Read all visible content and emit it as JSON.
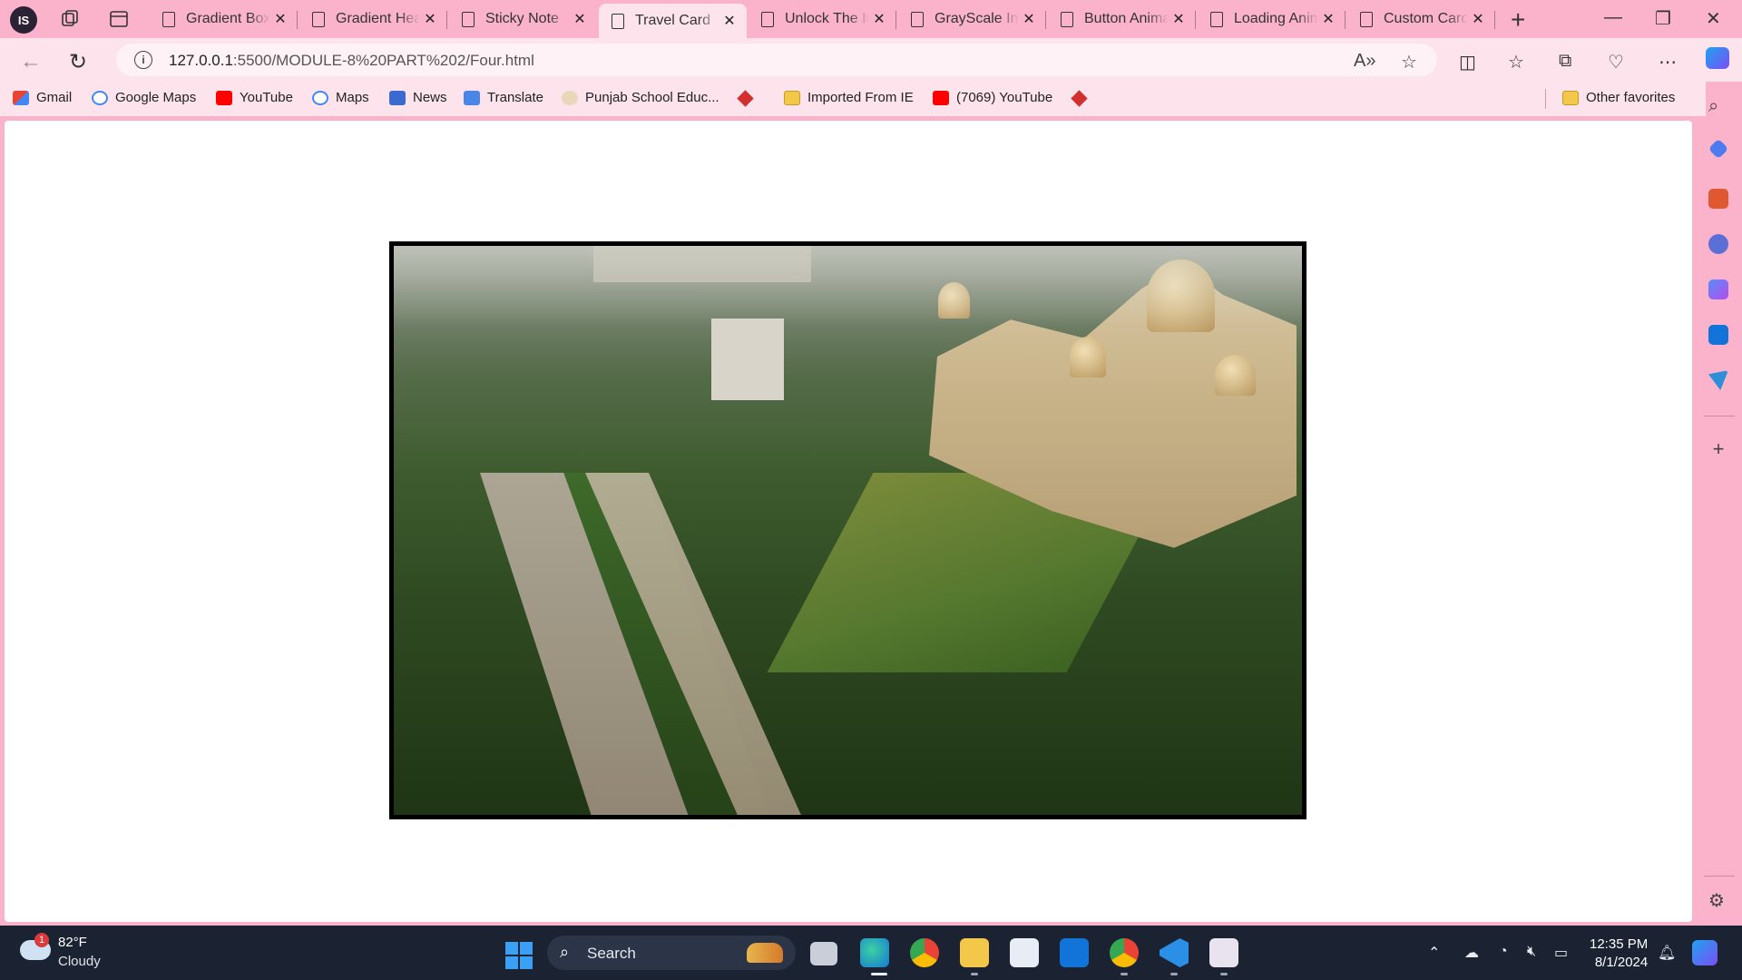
{
  "browser": {
    "profile_initials": "IS",
    "tabs": [
      {
        "title": "Gradient Box",
        "active": false
      },
      {
        "title": "Gradient Header",
        "active": false
      },
      {
        "title": "Sticky Note",
        "active": false
      },
      {
        "title": "Travel Card",
        "active": true
      },
      {
        "title": "Unlock The Image",
        "active": false
      },
      {
        "title": "GrayScale Image",
        "active": false
      },
      {
        "title": "Button Animation",
        "active": false
      },
      {
        "title": "Loading Animation",
        "active": false
      },
      {
        "title": "Custom Card",
        "active": false
      }
    ],
    "url_host": "127.0.0.1",
    "url_path": ":5500/MODULE-8%20PART%202/Four.html",
    "bookmarks": [
      {
        "label": "Gmail",
        "icon": "gmail-icon"
      },
      {
        "label": "Google Maps",
        "icon": "google-icon"
      },
      {
        "label": "YouTube",
        "icon": "youtube-icon"
      },
      {
        "label": "Maps",
        "icon": "google-icon"
      },
      {
        "label": "News",
        "icon": "news-icon"
      },
      {
        "label": "Translate",
        "icon": "translate-icon"
      },
      {
        "label": "Punjab School Educ...",
        "icon": "school-icon"
      },
      {
        "label": "",
        "icon": "diamond-icon"
      },
      {
        "label": "Imported From IE",
        "icon": "folder-icon"
      },
      {
        "label": "(7069) YouTube",
        "icon": "youtube-icon"
      },
      {
        "label": "",
        "icon": "diamond-icon"
      }
    ],
    "other_favorites": "Other favorites",
    "colors": {
      "chrome": "#fbb3cc",
      "toolbar": "#fde3ec",
      "taskbar": "#1b2333"
    }
  },
  "page": {
    "image_description_icon": "travel-photo"
  },
  "taskbar": {
    "weather_badge": "1",
    "temperature": "82°F",
    "condition": "Cloudy",
    "search_label": "Search",
    "time": "12:35 PM",
    "date": "8/1/2024"
  }
}
